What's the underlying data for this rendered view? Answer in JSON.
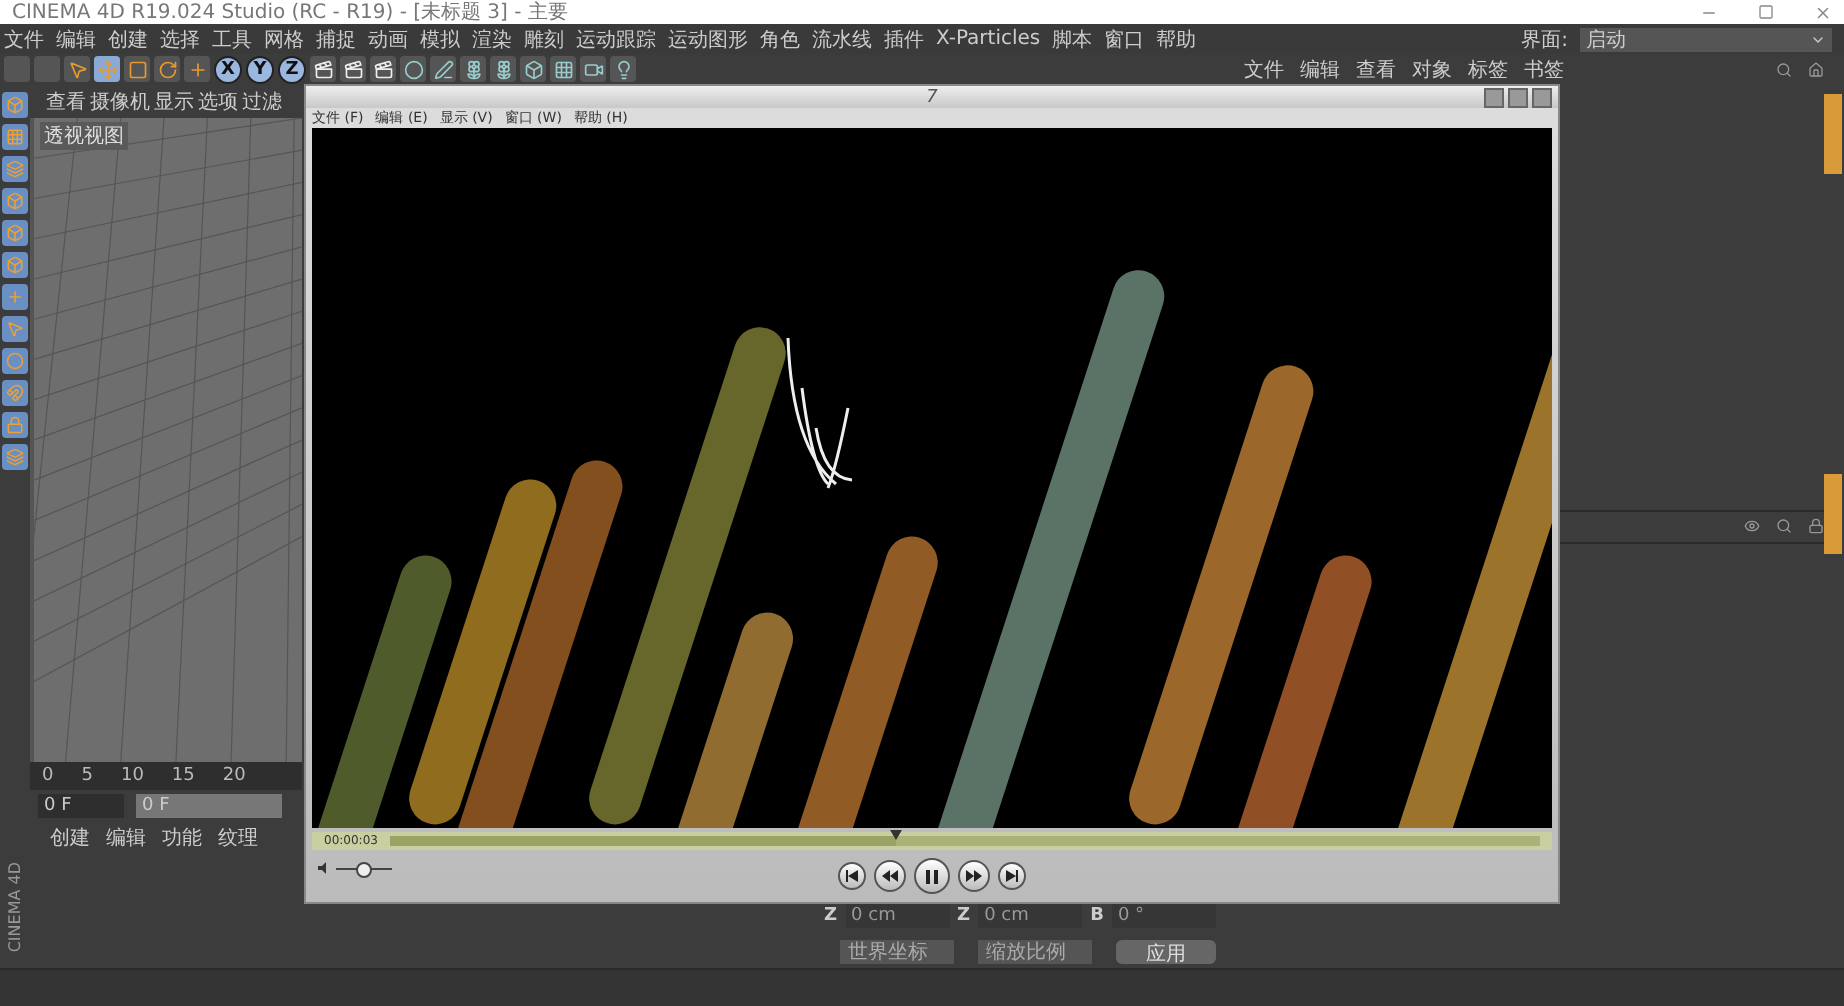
{
  "window": {
    "title": "CINEMA 4D R19.024 Studio (RC - R19) - [未标题 3] - 主要"
  },
  "menu_bar": [
    "文件",
    "编辑",
    "创建",
    "选择",
    "工具",
    "网格",
    "捕捉",
    "动画",
    "模拟",
    "渲染",
    "雕刻",
    "运动跟踪",
    "运动图形",
    "角色",
    "流水线",
    "插件",
    "X-Particles",
    "脚本",
    "窗口",
    "帮助"
  ],
  "layout": {
    "label": "界面:",
    "value": "启动"
  },
  "axis_buttons": [
    {
      "label": "X",
      "selected": true
    },
    {
      "label": "Y",
      "selected": true
    },
    {
      "label": "Z",
      "selected": true
    }
  ],
  "viewport": {
    "menu": [
      "查看",
      "摄像机",
      "显示",
      "选项",
      "过滤"
    ],
    "label": "透视视图"
  },
  "timeline": {
    "ticks": [
      "0",
      "5",
      "10",
      "15",
      "20"
    ],
    "start_field": "0 F",
    "current_field": "0 F"
  },
  "material_manager": {
    "menu": [
      "创建",
      "编辑",
      "功能",
      "纹理"
    ]
  },
  "object_manager": {
    "menu": [
      "文件",
      "编辑",
      "查看",
      "对象",
      "标签",
      "书签"
    ]
  },
  "coordinates": {
    "fields": [
      {
        "label": "Z",
        "value": "0 cm"
      },
      {
        "label": "Z",
        "value": "0 cm"
      },
      {
        "label": "B",
        "value": "0 °"
      }
    ],
    "dropdowns": [
      "世界坐标",
      "缩放比例"
    ],
    "apply": "应用"
  },
  "brand": "CINEMA 4D",
  "player": {
    "title": "7",
    "menu": [
      "文件 (F)",
      "编辑 (E)",
      "显示 (V)",
      "窗口 (W)",
      "帮助 (H)"
    ],
    "time": "00:00:03",
    "position": {
      "level": 0.44
    },
    "volume": {
      "level": 0.45
    }
  }
}
